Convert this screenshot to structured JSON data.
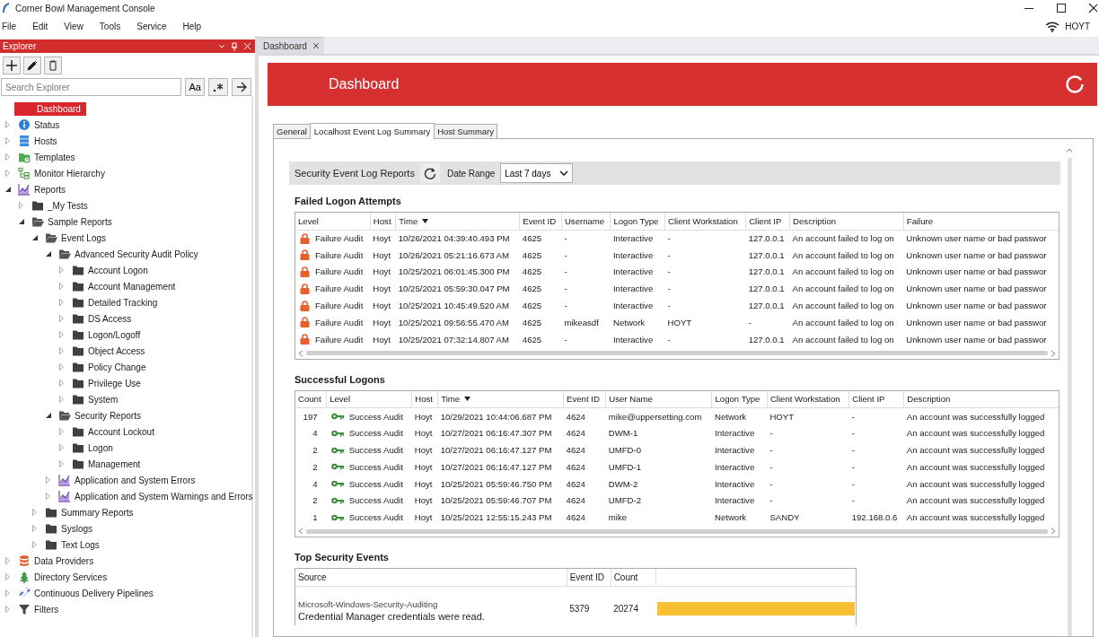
{
  "window": {
    "title": "Corner Bowl Management Console"
  },
  "menu": [
    "File",
    "Edit",
    "View",
    "Tools",
    "Service",
    "Help"
  ],
  "connection": {
    "host": "HOYT"
  },
  "explorer": {
    "title": "Explorer",
    "search": {
      "placeholder": "Search Explorer"
    },
    "match_case_button": "Aa",
    "tree": [
      {
        "label": "Dashboard",
        "kind": "page",
        "selected": true
      },
      {
        "label": "Status",
        "kind": "info",
        "expanded": false,
        "selected": false
      },
      {
        "label": "Hosts",
        "kind": "server",
        "expanded": false,
        "selected": false
      },
      {
        "label": "Templates",
        "kind": "template",
        "expanded": false,
        "selected": false
      },
      {
        "label": "Monitor Hierarchy",
        "kind": "hierarchy",
        "expanded": false,
        "selected": false
      },
      {
        "label": "Reports",
        "kind": "chart",
        "expanded": true,
        "selected": false,
        "children": [
          {
            "label": "_My Tests",
            "kind": "folder",
            "expanded": false,
            "selected": false
          },
          {
            "label": "Sample Reports",
            "kind": "folder",
            "expanded": true,
            "selected": false,
            "children": [
              {
                "label": "Event Logs",
                "kind": "folder",
                "expanded": true,
                "selected": false,
                "children": [
                  {
                    "label": "Advanced Security Audit Policy",
                    "kind": "folder",
                    "expanded": true,
                    "selected": false,
                    "children": [
                      {
                        "label": "Account Logon",
                        "kind": "folder",
                        "expanded": false,
                        "selected": false
                      },
                      {
                        "label": "Account Management",
                        "kind": "folder",
                        "expanded": false,
                        "selected": false
                      },
                      {
                        "label": "Detailed Tracking",
                        "kind": "folder",
                        "expanded": false,
                        "selected": false
                      },
                      {
                        "label": "DS Access",
                        "kind": "folder",
                        "expanded": false,
                        "selected": false
                      },
                      {
                        "label": "Logon/Logoff",
                        "kind": "folder",
                        "expanded": false,
                        "selected": false
                      },
                      {
                        "label": "Object Access",
                        "kind": "folder",
                        "expanded": false,
                        "selected": false
                      },
                      {
                        "label": "Policy Change",
                        "kind": "folder",
                        "expanded": false,
                        "selected": false
                      },
                      {
                        "label": "Privilege Use",
                        "kind": "folder",
                        "expanded": false,
                        "selected": false
                      },
                      {
                        "label": "System",
                        "kind": "folder",
                        "expanded": false,
                        "selected": false
                      }
                    ]
                  },
                  {
                    "label": "Security Reports",
                    "kind": "folder",
                    "expanded": true,
                    "selected": false,
                    "children": [
                      {
                        "label": "Account Lockout",
                        "kind": "folder",
                        "expanded": false,
                        "selected": false
                      },
                      {
                        "label": "Logon",
                        "kind": "folder",
                        "expanded": false,
                        "selected": false
                      },
                      {
                        "label": "Management",
                        "kind": "folder",
                        "expanded": false,
                        "selected": false
                      }
                    ]
                  },
                  {
                    "label": "Application and System Errors",
                    "kind": "chart",
                    "expanded": false,
                    "selected": false
                  },
                  {
                    "label": "Application and System Warnings and Errors",
                    "kind": "chart",
                    "expanded": false,
                    "selected": false
                  }
                ]
              },
              {
                "label": "Summary Reports",
                "kind": "folder",
                "expanded": false,
                "selected": false
              },
              {
                "label": "Syslogs",
                "kind": "folder",
                "expanded": false,
                "selected": false
              },
              {
                "label": "Text Logs",
                "kind": "folder",
                "expanded": false,
                "selected": false
              }
            ]
          }
        ]
      },
      {
        "label": "Data Providers",
        "kind": "database",
        "expanded": false,
        "selected": false
      },
      {
        "label": "Directory Services",
        "kind": "directory",
        "expanded": false,
        "selected": false
      },
      {
        "label": "Continuous Delivery Pipelines",
        "kind": "pipeline",
        "expanded": false,
        "selected": false
      },
      {
        "label": "Filters",
        "kind": "filter",
        "expanded": false,
        "selected": false
      }
    ]
  },
  "document_tabs": [
    {
      "label": "Dashboard",
      "selected": true
    }
  ],
  "header": {
    "title": "Dashboard"
  },
  "tabs": [
    {
      "label": "General",
      "selected": false
    },
    {
      "label": "Localhost Event Log Summary",
      "selected": true
    },
    {
      "label": "Host Summary",
      "selected": false
    }
  ],
  "toolbar": {
    "title": "Security Event Log Reports",
    "date_range_label": "Date Range",
    "date_range": "Last 7 days"
  },
  "failed_logons": {
    "title": "Failed Logon Attempts",
    "columns": [
      {
        "label": "Level",
        "sorted": false
      },
      {
        "label": "Host",
        "sorted": false
      },
      {
        "label": "Time",
        "sorted": true
      },
      {
        "label": "Event ID",
        "sorted": false
      },
      {
        "label": "Username",
        "sorted": false
      },
      {
        "label": "Logon Type",
        "sorted": false
      },
      {
        "label": "Client Workstation",
        "sorted": false
      },
      {
        "label": "Client IP",
        "sorted": false
      },
      {
        "label": "Description",
        "sorted": false
      },
      {
        "label": "Failure",
        "sorted": false
      }
    ],
    "rows": [
      {
        "kind": "failure",
        "cells": [
          "Failure Audit",
          "Hoyt",
          "10/26/2021 04:39:40.493 PM",
          "4625",
          "-",
          "Interactive",
          "-",
          "127.0.0.1",
          "An account failed to log on",
          "Unknown user name or bad passwor"
        ]
      },
      {
        "kind": "failure",
        "cells": [
          "Failure Audit",
          "Hoyt",
          "10/26/2021 05:21:16.673 AM",
          "4625",
          "-",
          "Interactive",
          "-",
          "127.0.0.1",
          "An account failed to log on",
          "Unknown user name or bad passwor"
        ]
      },
      {
        "kind": "failure",
        "cells": [
          "Failure Audit",
          "Hoyt",
          "10/25/2021 06:01:45.300 PM",
          "4625",
          "-",
          "Interactive",
          "-",
          "127.0.0.1",
          "An account failed to log on",
          "Unknown user name or bad passwor"
        ]
      },
      {
        "kind": "failure",
        "cells": [
          "Failure Audit",
          "Hoyt",
          "10/25/2021 05:59:30.047 PM",
          "4625",
          "-",
          "Interactive",
          "-",
          "127.0.0.1",
          "An account failed to log on",
          "Unknown user name or bad passwor"
        ]
      },
      {
        "kind": "failure",
        "cells": [
          "Failure Audit",
          "Hoyt",
          "10/25/2021 10:45:49.520 AM",
          "4625",
          "-",
          "Interactive",
          "-",
          "127.0.0.1",
          "An account failed to log on",
          "Unknown user name or bad passwor"
        ]
      },
      {
        "kind": "failure",
        "cells": [
          "Failure Audit",
          "Hoyt",
          "10/25/2021 09:56:55.470 AM",
          "4625",
          "mikeasdf",
          "Network",
          "HOYT",
          "-",
          "An account failed to log on",
          "Unknown user name or bad passwor"
        ]
      },
      {
        "kind": "failure",
        "cells": [
          "Failure Audit",
          "Hoyt",
          "10/25/2021 07:32:14.807 AM",
          "4625",
          "-",
          "Interactive",
          "-",
          "127.0.0.1",
          "An account failed to log on",
          "Unknown user name or bad passwor"
        ]
      }
    ]
  },
  "successful_logons": {
    "title": "Successful Logons",
    "columns": [
      {
        "label": "Count",
        "sorted": false
      },
      {
        "label": "Level",
        "sorted": false
      },
      {
        "label": "Host",
        "sorted": false
      },
      {
        "label": "Time",
        "sorted": true
      },
      {
        "label": "Event ID",
        "sorted": false
      },
      {
        "label": "User Name",
        "sorted": false
      },
      {
        "label": "Logon Type",
        "sorted": false
      },
      {
        "label": "Client Workstation",
        "sorted": false
      },
      {
        "label": "Client IP",
        "sorted": false
      },
      {
        "label": "Description",
        "sorted": false
      }
    ],
    "rows": [
      {
        "kind": "success",
        "cells": [
          "197",
          "Success Audit",
          "Hoyt",
          "10/29/2021 10:44:06.687 PM",
          "4624",
          "mike@uppersetting.com",
          "Network",
          "HOYT",
          "-",
          "An account was successfully logged"
        ]
      },
      {
        "kind": "success",
        "cells": [
          "4",
          "Success Audit",
          "Hoyt",
          "10/27/2021 06:16:47.307 PM",
          "4624",
          "DWM-1",
          "Interactive",
          "-",
          "-",
          "An account was successfully logged"
        ]
      },
      {
        "kind": "success",
        "cells": [
          "2",
          "Success Audit",
          "Hoyt",
          "10/27/2021 06:16:47.127 PM",
          "4624",
          "UMFD-0",
          "Interactive",
          "-",
          "-",
          "An account was successfully logged"
        ]
      },
      {
        "kind": "success",
        "cells": [
          "2",
          "Success Audit",
          "Hoyt",
          "10/27/2021 06:16:47.127 PM",
          "4624",
          "UMFD-1",
          "Interactive",
          "-",
          "-",
          "An account was successfully logged"
        ]
      },
      {
        "kind": "success",
        "cells": [
          "4",
          "Success Audit",
          "Hoyt",
          "10/25/2021 05:59:46.750 PM",
          "4624",
          "DWM-2",
          "Interactive",
          "-",
          "-",
          "An account was successfully logged"
        ]
      },
      {
        "kind": "success",
        "cells": [
          "2",
          "Success Audit",
          "Hoyt",
          "10/25/2021 05:59:46.707 PM",
          "4624",
          "UMFD-2",
          "Interactive",
          "-",
          "-",
          "An account was successfully logged"
        ]
      },
      {
        "kind": "success",
        "cells": [
          "1",
          "Success Audit",
          "Hoyt",
          "10/25/2021 12:55:15.243 PM",
          "4624",
          "mike",
          "Network",
          "SANDY",
          "192.168.0.6",
          "An account was successfully logged"
        ]
      }
    ]
  },
  "top_security_events": {
    "title": "Top Security Events",
    "columns": [
      "Source",
      "Event ID",
      "Count"
    ],
    "rows": [
      {
        "source": "Microsoft-Windows-Security-Auditing",
        "message": "Credential Manager credentials were read.",
        "event_id": "5379",
        "count": "20274",
        "level": 1
      }
    ]
  }
}
